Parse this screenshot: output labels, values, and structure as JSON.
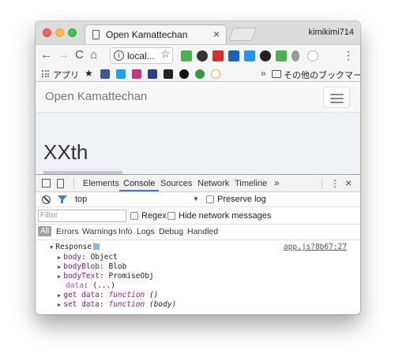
{
  "browser": {
    "tab_title": "Open Kamattechan",
    "profile_name": "kimikimi714",
    "url_display": "local...",
    "bookmarks": {
      "apps_label": "アプリ",
      "more_label": "»",
      "other_label": "その他のブックマーク"
    }
  },
  "page": {
    "brand": "Open Kamattechan",
    "heading": "XXth"
  },
  "devtools": {
    "tabs": [
      "Elements",
      "Console",
      "Sources",
      "Network",
      "Timeline"
    ],
    "active_tab": "Console",
    "more_tabs": "»",
    "context": "top",
    "preserve_log_label": "Preserve log",
    "filter_placeholder": "Filter",
    "regex_label": "Regex",
    "hide_network_label": "Hide network messages",
    "levels": [
      "All",
      "Errors",
      "Warnings",
      "Info",
      "Logs",
      "Debug",
      "Handled"
    ],
    "log": {
      "object_name": "Response",
      "source": "app.js?8b67:27",
      "props": [
        {
          "key": "body",
          "value": "Object",
          "expandable": true
        },
        {
          "key": "bodyBlob",
          "value": "Blob",
          "expandable": true
        },
        {
          "key": "bodyText",
          "value": "PromiseObj",
          "expandable": true
        },
        {
          "key": "data",
          "value": "(...)",
          "expandable": false
        },
        {
          "key": "get data",
          "value_kw": "function",
          "value": "()",
          "expandable": true
        },
        {
          "key": "set data",
          "value_kw": "function",
          "value": "(body)",
          "expandable": true
        }
      ]
    }
  },
  "colors": {
    "accent": "#3879d9",
    "close": "#fc605b",
    "minimize": "#fdbc40",
    "maximize": "#34c84a"
  }
}
